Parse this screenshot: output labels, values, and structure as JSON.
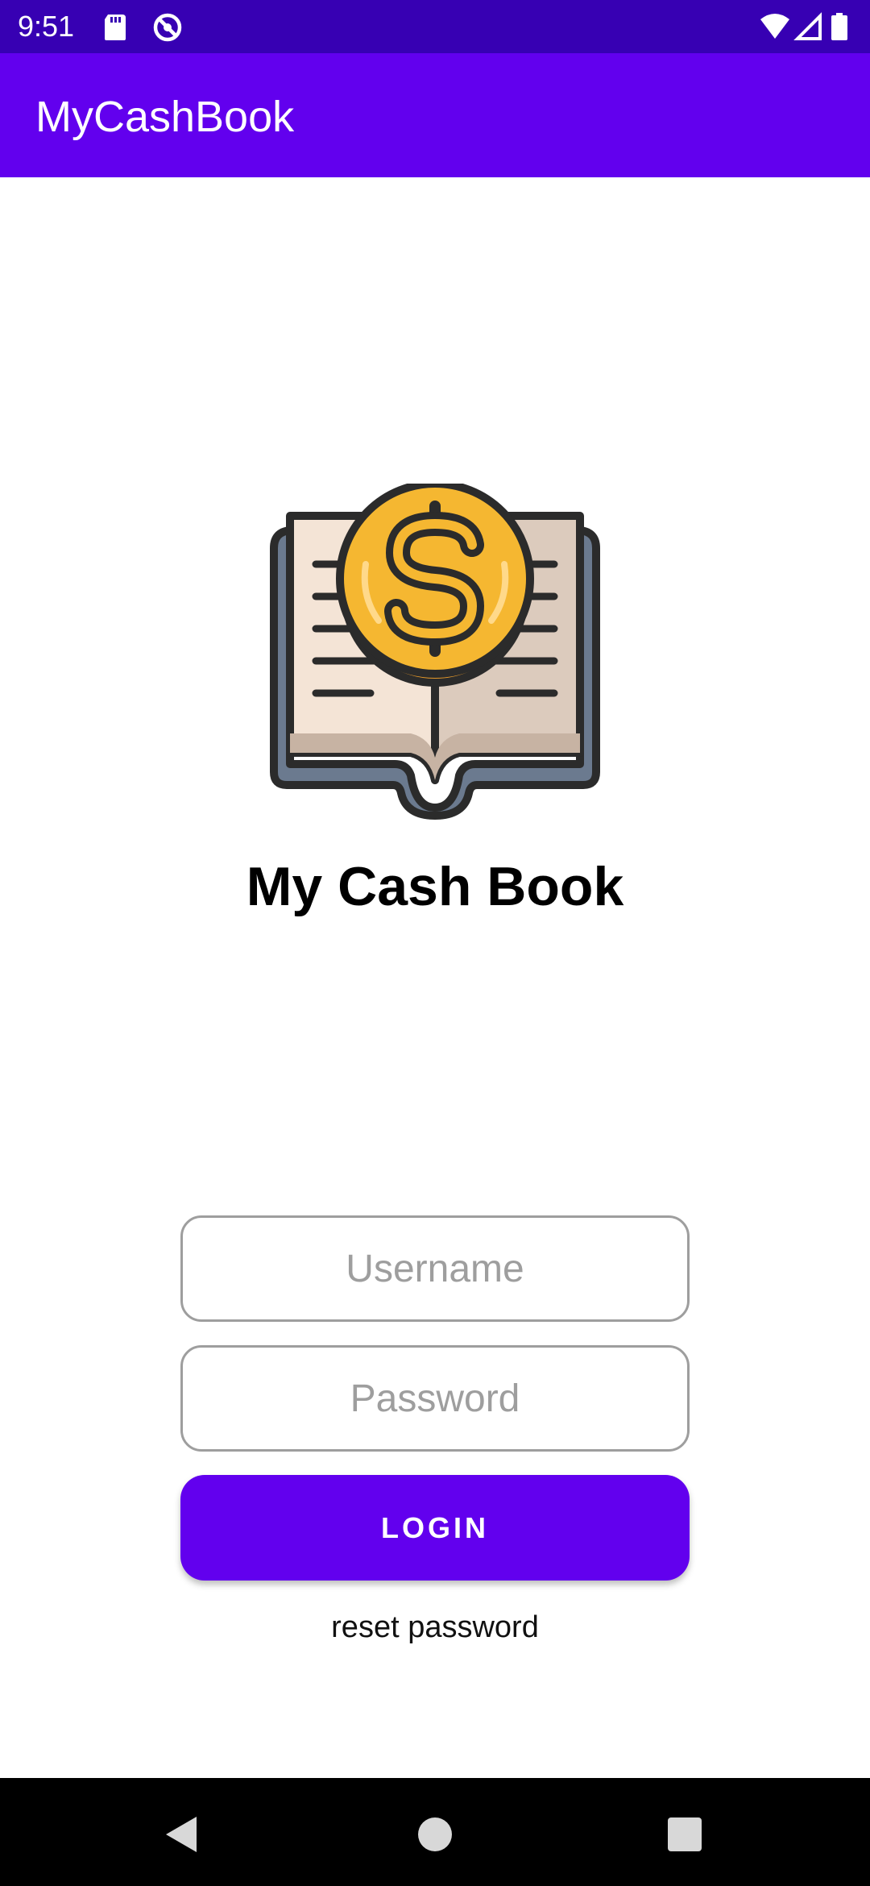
{
  "status_bar": {
    "time": "9:51",
    "left_icons": [
      "sd-card-icon",
      "do-not-disturb-icon"
    ],
    "right_icons": [
      "wifi-icon",
      "cellular-signal-icon",
      "battery-icon"
    ]
  },
  "app_bar": {
    "title": "MyCashBook"
  },
  "login": {
    "brand_title": "My Cash Book",
    "logo_icon": "cash-book-logo-icon",
    "username_placeholder": "Username",
    "password_placeholder": "Password",
    "login_label": "LOGIN",
    "reset_label": "reset password"
  },
  "nav_bar": {
    "buttons": [
      "back-icon",
      "home-icon",
      "recents-icon"
    ]
  },
  "colors": {
    "status_bar": "#3700b3",
    "primary": "#6200ee",
    "background": "#ffffff",
    "nav_bar": "#000000",
    "coin": "#f5b731",
    "coin_shadow": "#e89a2a",
    "book_cover": "#6b7a8f",
    "book_pages": "#f4e4d6"
  }
}
